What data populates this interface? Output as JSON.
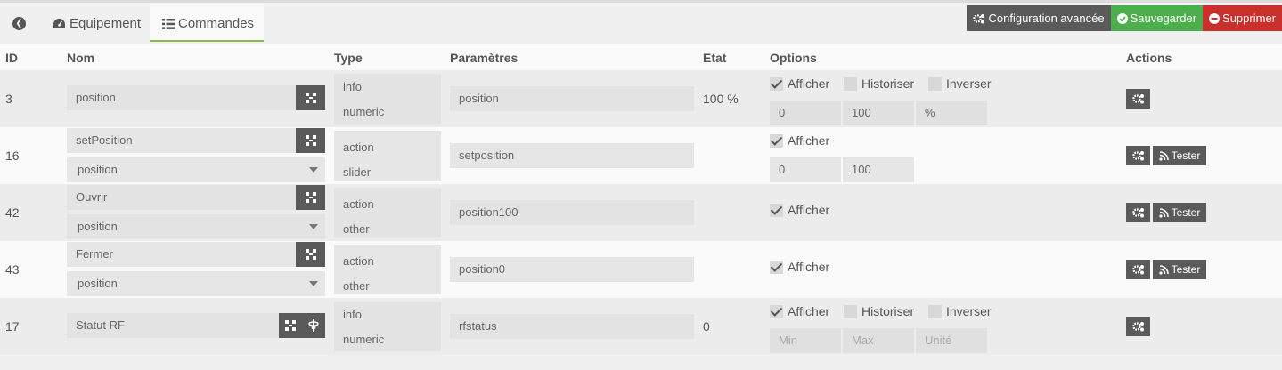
{
  "tabs": {
    "equipement": "Equipement",
    "commandes": "Commandes"
  },
  "buttons": {
    "config": "Configuration avancée",
    "save": "Sauvegarder",
    "delete": "Supprimer"
  },
  "columns": {
    "id": "ID",
    "nom": "Nom",
    "type": "Type",
    "params": "Paramètres",
    "etat": "Etat",
    "options": "Options",
    "actions": "Actions"
  },
  "labels": {
    "afficher": "Afficher",
    "historiser": "Historiser",
    "inverser": "Inverser",
    "tester": "Tester"
  },
  "rows": [
    {
      "id": "3",
      "name": "position",
      "type1": "info",
      "type2": "numeric",
      "param": "position",
      "etat": "100 %",
      "min": "0",
      "max": "100",
      "unit": "%"
    },
    {
      "id": "16",
      "name": "setPosition",
      "select": "position",
      "type1": "action",
      "type2": "slider",
      "param": "setposition",
      "min": "0",
      "max": "100"
    },
    {
      "id": "42",
      "name": "Ouvrir",
      "select": "position",
      "type1": "action",
      "type2": "other",
      "param": "position100"
    },
    {
      "id": "43",
      "name": "Fermer",
      "select": "position",
      "type1": "action",
      "type2": "other",
      "param": "position0"
    },
    {
      "id": "17",
      "name": "Statut RF",
      "type1": "info",
      "type2": "numeric",
      "param": "rfstatus",
      "etat": "0",
      "min_ph": "Min",
      "max_ph": "Max",
      "unit_ph": "Unité"
    }
  ],
  "colors": {
    "save": "#4cae4c",
    "delete": "#c9302c",
    "dark": "#5a5a5a",
    "tab_underline": "#8db84a"
  }
}
